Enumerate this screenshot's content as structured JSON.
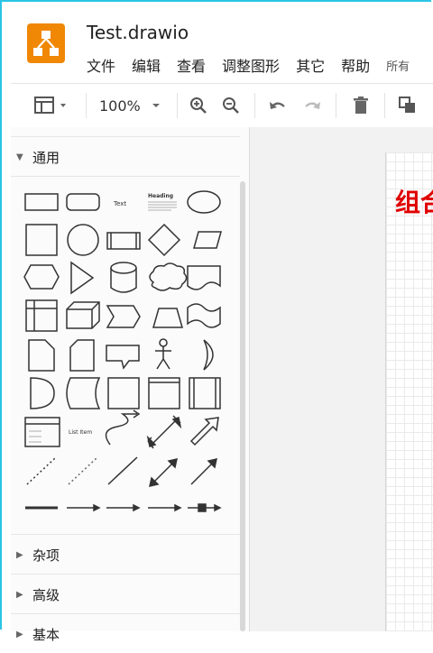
{
  "app": {
    "title": "Test.drawio"
  },
  "menu": {
    "items": [
      "文件",
      "编辑",
      "查看",
      "调整图形",
      "其它",
      "帮助"
    ],
    "extra": "所有"
  },
  "toolbar": {
    "zoom": "100%"
  },
  "sidebar": {
    "sections": [
      "通用",
      "杂项",
      "高级",
      "基本"
    ],
    "shape_text": {
      "text": "Text",
      "heading": "Heading",
      "list_item": "List Item"
    }
  },
  "canvas": {
    "title": "组合"
  },
  "colors": {
    "logo": "#f08705",
    "frame": "#2ac4e6",
    "canvas_title": "#e00000"
  }
}
